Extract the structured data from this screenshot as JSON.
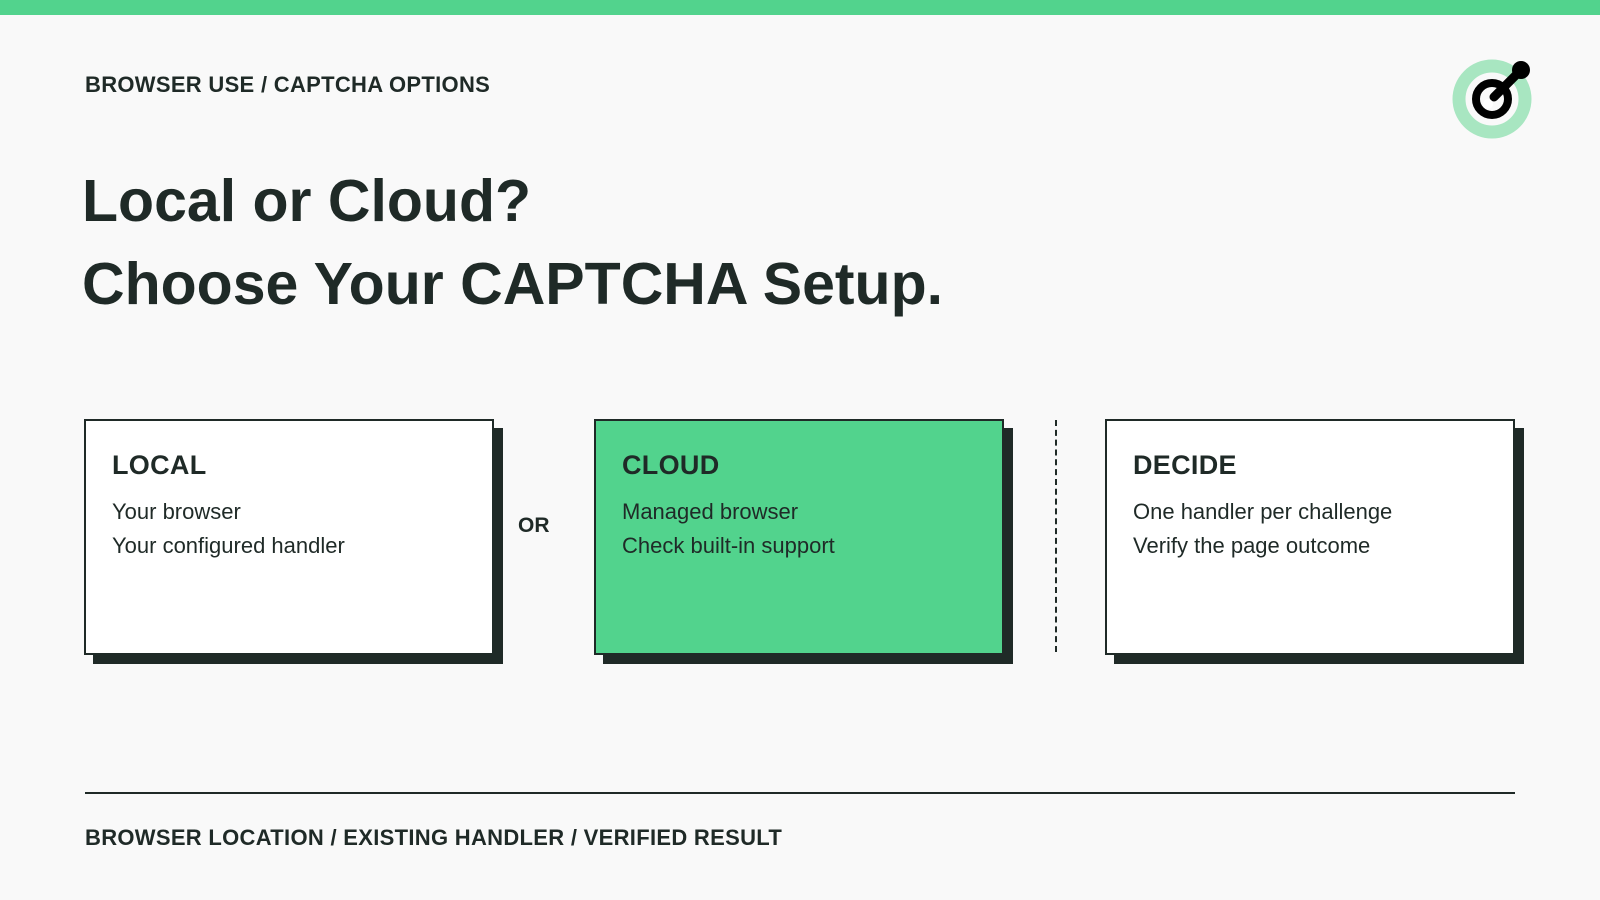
{
  "header": {
    "breadcrumb": "BROWSER USE / CAPTCHA OPTIONS",
    "logo_icon": "browser-use-logo-icon"
  },
  "title": {
    "line1": "Local or Cloud?",
    "line2": "Choose Your CAPTCHA Setup."
  },
  "cards": [
    {
      "title": "LOCAL",
      "lines": [
        "Your browser",
        "Your configured handler"
      ],
      "background": "#ffffff"
    },
    {
      "title": "CLOUD",
      "lines": [
        "Managed browser",
        "Check built-in support"
      ],
      "background": "#52d38d"
    },
    {
      "title": "DECIDE",
      "lines": [
        "One handler per challenge",
        "Verify the page outcome"
      ],
      "background": "#ffffff"
    }
  ],
  "separator_label": "OR",
  "footer": {
    "text": "BROWSER LOCATION / EXISTING HANDLER / VERIFIED RESULT"
  },
  "colors": {
    "accent": "#52d38d",
    "ink": "#1f2a27",
    "background": "#f9f9f9",
    "logo_light": "#a8e6c1"
  }
}
